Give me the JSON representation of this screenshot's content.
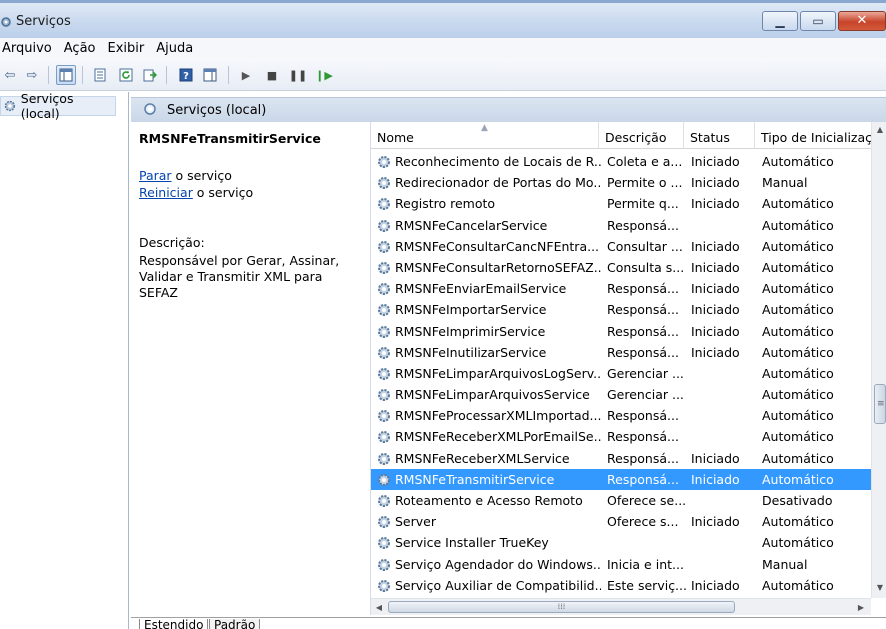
{
  "window": {
    "title": "Serviços"
  },
  "menu": [
    "Arquivo",
    "Ação",
    "Exibir",
    "Ajuda"
  ],
  "tree": {
    "root": "Serviços (local)"
  },
  "pane": {
    "header": "Serviços (local)"
  },
  "details": {
    "service_name": "RMSNFeTransmitirService",
    "stop_link": "Parar",
    "stop_rest": " o serviço",
    "restart_link": "Reiniciar",
    "restart_rest": " o serviço",
    "description_title": "Descrição:",
    "description_text": "Responsável por Gerar, Assinar, Validar e Transmitir XML para SEFAZ"
  },
  "columns": [
    "Nome",
    "Descrição",
    "Status",
    "Tipo de Inicializaç"
  ],
  "services": [
    {
      "name": "Reconhecimento de Locais de R...",
      "desc": "Coleta e a...",
      "status": "Iniciado",
      "startup": "Automático"
    },
    {
      "name": "Redirecionador de Portas do Mo...",
      "desc": "Permite o ...",
      "status": "Iniciado",
      "startup": "Manual"
    },
    {
      "name": "Registro remoto",
      "desc": "Permite q...",
      "status": "Iniciado",
      "startup": "Automático"
    },
    {
      "name": "RMSNFeCancelarService",
      "desc": "Responsá...",
      "status": "",
      "startup": "Automático"
    },
    {
      "name": "RMSNFeConsultarCancNFEntra...",
      "desc": "Consultar ...",
      "status": "Iniciado",
      "startup": "Automático"
    },
    {
      "name": "RMSNFeConsultarRetornoSEFAZ...",
      "desc": "Consulta s...",
      "status": "Iniciado",
      "startup": "Automático"
    },
    {
      "name": "RMSNFeEnviarEmailService",
      "desc": "Responsá...",
      "status": "Iniciado",
      "startup": "Automático"
    },
    {
      "name": "RMSNFeImportarService",
      "desc": "Responsá...",
      "status": "Iniciado",
      "startup": "Automático"
    },
    {
      "name": "RMSNFeImprimirService",
      "desc": "Responsá...",
      "status": "Iniciado",
      "startup": "Automático"
    },
    {
      "name": "RMSNFeInutilizarService",
      "desc": "Responsá...",
      "status": "Iniciado",
      "startup": "Automático"
    },
    {
      "name": "RMSNFeLimparArquivosLogServ...",
      "desc": "Gerenciar ...",
      "status": "",
      "startup": "Automático"
    },
    {
      "name": "RMSNFeLimparArquivosService",
      "desc": "Gerenciar ...",
      "status": "",
      "startup": "Automático"
    },
    {
      "name": "RMSNFeProcessarXMLImportad...",
      "desc": "Responsá...",
      "status": "",
      "startup": "Automático"
    },
    {
      "name": "RMSNFeReceberXMLPorEmailSe...",
      "desc": "Responsá...",
      "status": "",
      "startup": "Automático"
    },
    {
      "name": "RMSNFeReceberXMLService",
      "desc": "Responsá...",
      "status": "Iniciado",
      "startup": "Automático"
    },
    {
      "name": "RMSNFeTransmitirService",
      "desc": "Responsá...",
      "status": "Iniciado",
      "startup": "Automático",
      "selected": true
    },
    {
      "name": "Roteamento e Acesso Remoto",
      "desc": "Oferece se...",
      "status": "",
      "startup": "Desativado"
    },
    {
      "name": "Server",
      "desc": "Oferece s...",
      "status": "Iniciado",
      "startup": "Automático"
    },
    {
      "name": "Service Installer TrueKey",
      "desc": "",
      "status": "",
      "startup": "Automático"
    },
    {
      "name": "Serviço Agendador do Windows...",
      "desc": "Inicia e int...",
      "status": "",
      "startup": "Manual"
    },
    {
      "name": "Serviço Auxiliar de Compatibilid...",
      "desc": "Este serviç...",
      "status": "Iniciado",
      "startup": "Automático"
    }
  ],
  "tabs": [
    "Estendido",
    "Padrão"
  ],
  "colors": {
    "selection": "#3399ff",
    "link": "#0645ad"
  }
}
